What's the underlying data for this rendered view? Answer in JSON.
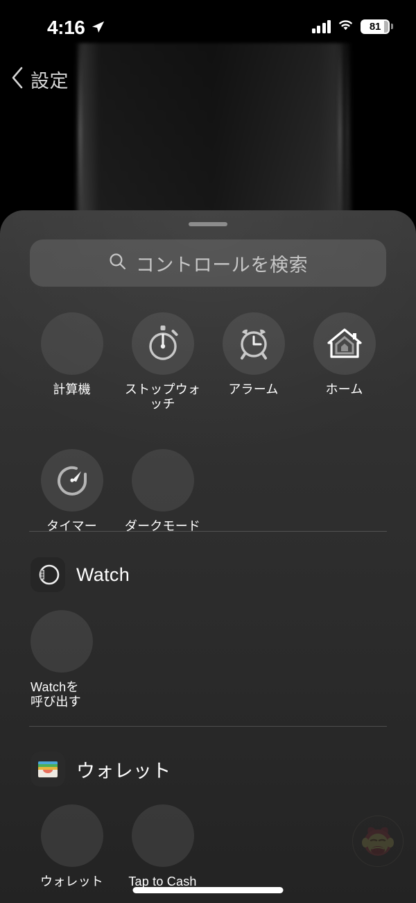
{
  "status_bar": {
    "time": "4:16",
    "location_icon": "location-arrow-icon",
    "signal_icon": "cellular-signal-icon",
    "wifi_icon": "wifi-icon",
    "battery_percent": "81"
  },
  "nav": {
    "back_icon": "chevron-left-icon",
    "back_label": "設定"
  },
  "sheet": {
    "grabber": "sheet-grabber"
  },
  "search": {
    "icon": "search-icon",
    "placeholder": "コントロールを検索"
  },
  "suggested_controls": [
    {
      "label": "計算機",
      "icon": "calculator-icon"
    },
    {
      "label": "ストップウォッチ",
      "icon": "stopwatch-icon"
    },
    {
      "label": "アラーム",
      "icon": "alarm-clock-icon"
    },
    {
      "label": "ホーム",
      "icon": "home-house-icon"
    },
    {
      "label": "タイマー",
      "icon": "timer-icon"
    },
    {
      "label": "ダークモード",
      "icon": "dark-mode-icon"
    }
  ],
  "sections": [
    {
      "title": "Watch",
      "app_icon": "apple-watch-icon",
      "controls": [
        {
          "label": "Watchを\n呼び出す",
          "line1": "Watchを",
          "line2": "呼び出す",
          "icon": "ping-watch-icon"
        }
      ]
    },
    {
      "title": "ウォレット",
      "app_icon": "wallet-icon",
      "controls": [
        {
          "label": "ウォレット",
          "icon": "wallet-control-icon"
        },
        {
          "label": "Tap to Cash",
          "icon": "tap-to-cash-icon"
        }
      ]
    }
  ],
  "watermark": {
    "name": "monkey-logo-watermark"
  },
  "home_indicator": "home-indicator",
  "colors": {
    "sheet_top": "#3a3a3a",
    "sheet_bottom": "#232323",
    "bubble": "rgba(128,128,128,0.24)",
    "search_field": "rgba(120,120,120,0.38)",
    "label_text": "#ffffff",
    "back_text": "#d6d6d6",
    "divider": "rgba(255,255,255,0.18)",
    "battery_fill": "#ffffff"
  }
}
